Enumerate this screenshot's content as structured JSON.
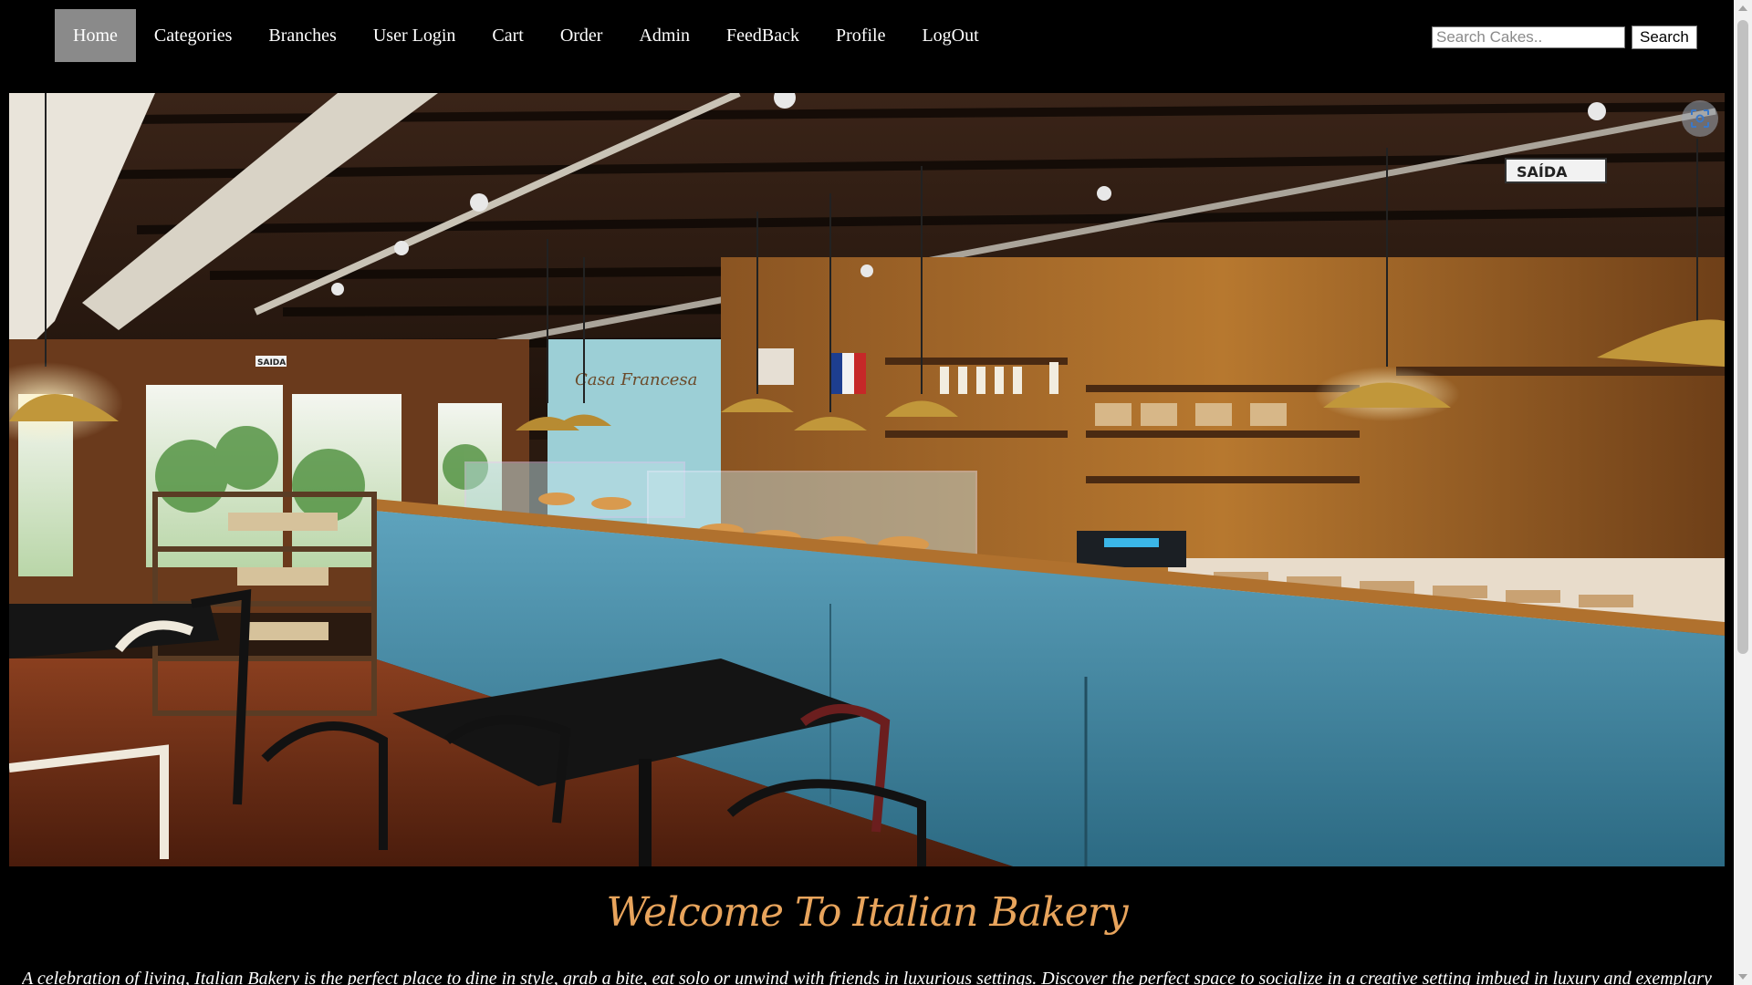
{
  "nav": {
    "items": [
      {
        "label": "Home",
        "active": true
      },
      {
        "label": "Categories",
        "active": false
      },
      {
        "label": "Branches",
        "active": false
      },
      {
        "label": "User Login",
        "active": false
      },
      {
        "label": "Cart",
        "active": false
      },
      {
        "label": "Order",
        "active": false
      },
      {
        "label": "Admin",
        "active": false
      },
      {
        "label": "FeedBack",
        "active": false
      },
      {
        "label": "Profile",
        "active": false
      },
      {
        "label": "LogOut",
        "active": false
      }
    ]
  },
  "search": {
    "placeholder": "Search Cakes..",
    "value": "",
    "button_label": "Search"
  },
  "hero": {
    "exit_sign": "SAÍDA",
    "exit_sign_small": "SAIDA",
    "shop_sign": "Casa Francesa",
    "lens_icon": "visual-search-icon"
  },
  "main": {
    "welcome_title": "Welcome To Italian Bakery",
    "intro": "A celebration of living, Italian Bakery is the perfect place to dine in style, grab a bite, eat solo or unwind with friends in luxurious settings. Discover the perfect space to socialize in a creative setting imbued in luxury and exemplary"
  },
  "colors": {
    "background": "#000000",
    "nav_active": "#8a8a8a",
    "welcome_title": "#e8a45c",
    "counter_blue": "#4a90a8"
  }
}
